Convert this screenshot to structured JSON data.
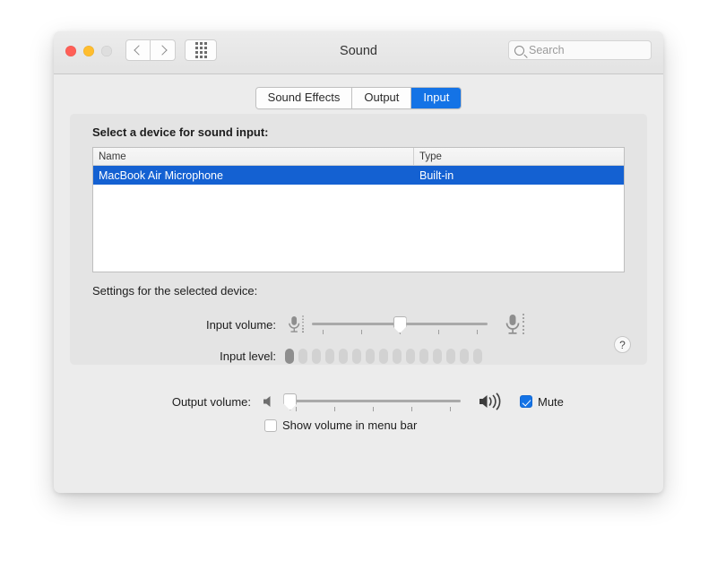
{
  "window": {
    "title": "Sound",
    "traffic_lights": [
      "close",
      "minimize",
      "zoom"
    ],
    "nav": {
      "back": "back-chevron",
      "forward": "forward-chevron",
      "grid": "show-all-grid"
    }
  },
  "search": {
    "placeholder": "Search",
    "value": "",
    "icon": "search-icon"
  },
  "tabs": [
    {
      "label": "Sound Effects",
      "selected": false
    },
    {
      "label": "Output",
      "selected": false
    },
    {
      "label": "Input",
      "selected": true
    }
  ],
  "panel": {
    "device_prompt": "Select a device for sound input:",
    "table": {
      "columns": [
        "Name",
        "Type"
      ],
      "rows": [
        {
          "name": "MacBook Air Microphone",
          "type": "Built-in",
          "selected": true
        }
      ]
    },
    "settings_label": "Settings for the selected device:",
    "input_volume": {
      "label": "Input volume:",
      "value_percent": 50,
      "min_icon": "microphone-small-icon",
      "max_icon": "microphone-large-icon",
      "tick_count": 5
    },
    "input_level": {
      "label": "Input level:",
      "segments_total": 15,
      "segments_active": 1
    },
    "help": {
      "label": "?",
      "icon": "help-icon"
    }
  },
  "output": {
    "label": "Output volume:",
    "value_percent": 3,
    "min_icon": "speaker-mute-icon",
    "max_icon": "speaker-loud-icon",
    "tick_count": 5,
    "mute": {
      "label": "Mute",
      "checked": true
    },
    "show_in_menu_bar": {
      "label": "Show volume in menu bar",
      "checked": false
    }
  },
  "colors": {
    "accent_blue": "#1473e6",
    "selection_blue": "#1461d2",
    "window_bg": "#ececec",
    "panel_bg": "#e4e4e4",
    "traffic_red": "#ff5f57",
    "traffic_yellow": "#ffbd2e",
    "traffic_gray": "#dedede"
  }
}
